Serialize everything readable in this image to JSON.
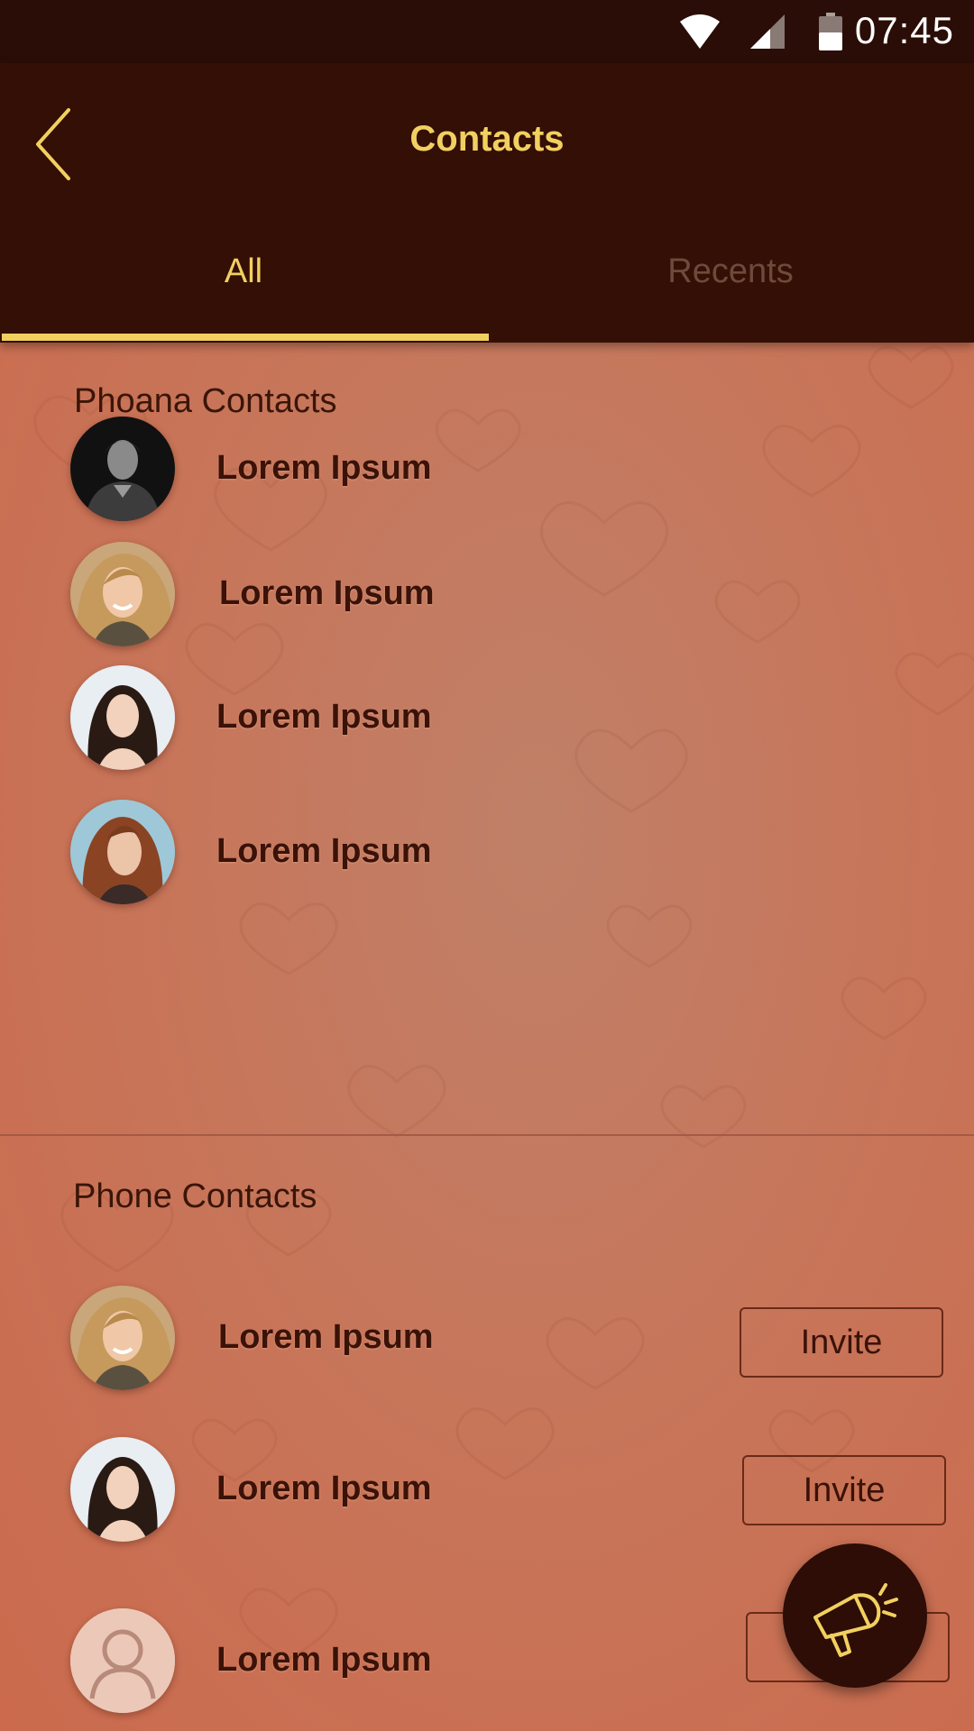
{
  "status_bar": {
    "time": "07:45"
  },
  "app_bar": {
    "title": "Contacts"
  },
  "tabs": [
    {
      "label": "All",
      "active": true
    },
    {
      "label": "Recents",
      "active": false
    }
  ],
  "phoana_contacts": {
    "title": "Phoana Contacts",
    "items": [
      {
        "name": "Lorem Ipsum",
        "avatar": "man-dark-photo"
      },
      {
        "name": "Lorem Ipsum",
        "avatar": "blonde-woman-photo"
      },
      {
        "name": "Lorem Ipsum",
        "avatar": "asian-woman-photo"
      },
      {
        "name": "Lorem Ipsum",
        "avatar": "redhead-woman-photo"
      }
    ]
  },
  "phone_contacts": {
    "title": "Phone Contacts",
    "items": [
      {
        "name": "Lorem Ipsum",
        "avatar": "blonde-woman-photo",
        "action": "Invite"
      },
      {
        "name": "Lorem Ipsum",
        "avatar": "asian-woman-photo",
        "action": "Invite"
      },
      {
        "name": "Lorem Ipsum",
        "avatar": "default-person-icon",
        "action": "Invite"
      }
    ]
  },
  "colors": {
    "app_bar": "#340f06",
    "status_bar": "#2a0d06",
    "accent": "#f2d060",
    "content_background": "#c87458",
    "text_dark": "#3a1208"
  },
  "icons": {
    "back": "chevron-left-icon",
    "fab": "megaphone-icon"
  }
}
